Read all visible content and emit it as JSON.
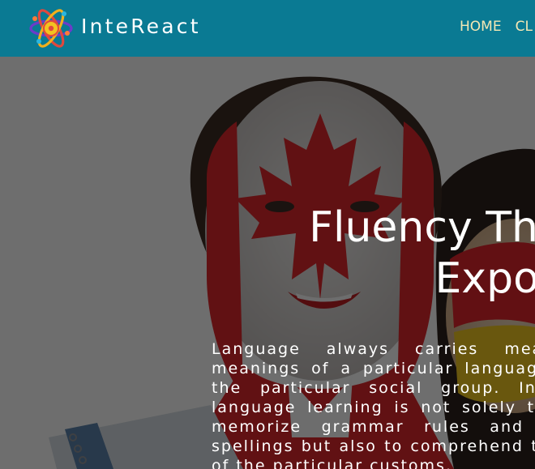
{
  "header": {
    "brand": "InteReact",
    "nav": [
      {
        "label": "HOME"
      },
      {
        "label": "CL"
      }
    ],
    "colors": {
      "bar": "#0a7a93",
      "nav_text": "#f4e8b4"
    }
  },
  "hero": {
    "title_line1": "Fluency Throug",
    "title_line2": "Expos",
    "paragraph": "Language always carries meaning. The meanings of a particular language represent the particular social group. In InteReact, language learning is not solely to learn and memorize grammar rules and hard word spellings but also to comprehend the behavior of the particular customs.",
    "image": "faces painted with the canadian flag"
  }
}
